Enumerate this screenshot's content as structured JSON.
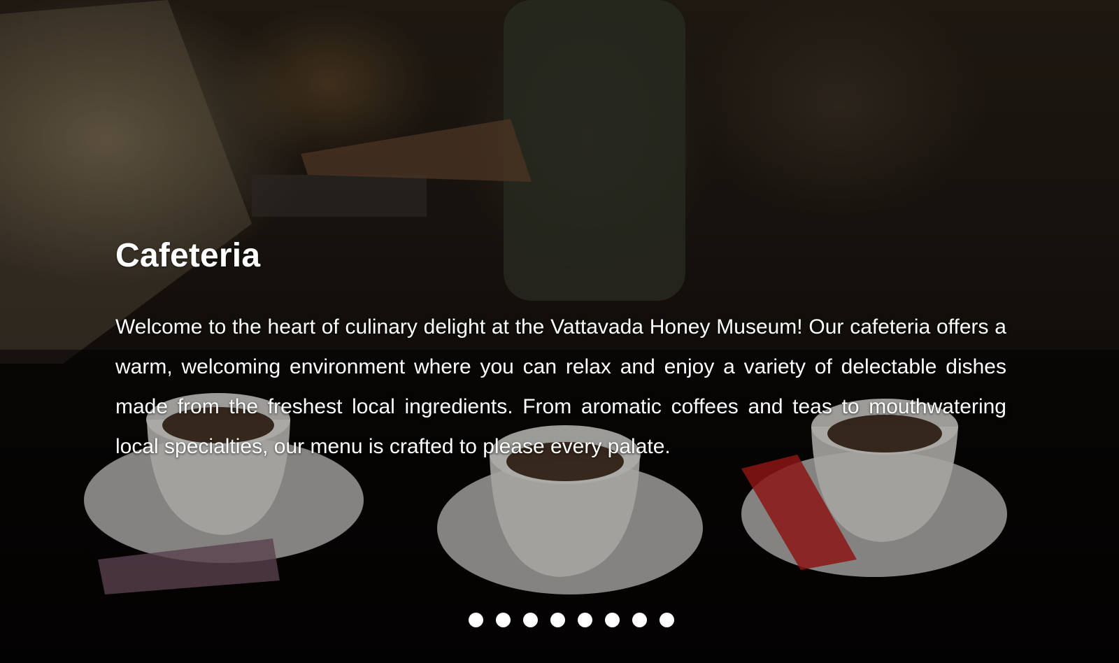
{
  "slide": {
    "title": "Cafeteria",
    "description": "Welcome to the heart of culinary delight at the Vattavada Honey Museum! Our cafeteria offers a warm, welcoming environment where you can relax and enjoy a variety of delectable dishes made from the freshest local ingredients. From aromatic coffees and teas to mouthwatering local specialties, our menu is crafted to please every palate."
  },
  "pagination": {
    "dot_count": 8
  },
  "colors": {
    "text": "#ffffff",
    "dot": "#ffffff"
  }
}
